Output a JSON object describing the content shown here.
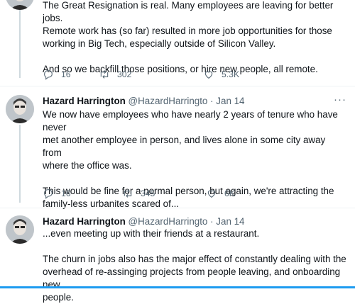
{
  "tweets": [
    {
      "author_name": "",
      "author_handle": "",
      "date": "",
      "text": "The Great Resignation is real. Many employees are leaving for better jobs.\nRemote work has (so far) resulted in more job opportunities for those\nworking in Big Tech, especially outside of Silicon Valley.\n\nAnd so we backfill those positions, or hire new people, all remote.",
      "replies": "16",
      "retweets": "302",
      "likes": "5.3K"
    },
    {
      "author_name": "Hazard Harrington",
      "author_handle": "@HazardHarringto",
      "date": "· Jan 14",
      "text": "We now have employees who have nearly 2 years of tenure who have never\nmet another employee in person, and lives alone in some city away from\nwhere the office was.\n\nThis would be fine for a normal person, but again, we're attracting the\nfamily-less urbanites scared of...",
      "replies": "16",
      "retweets": "345",
      "likes": "6K"
    },
    {
      "author_name": "Hazard Harrington",
      "author_handle": "@HazardHarringto",
      "date": "· Jan 14",
      "text": "...even meeting up with their friends at a restaurant.\n\nThe churn in jobs also has the major effect of constantly dealing with the\noverhead of re-assinging projects from people leaving, and onboarding new\npeople.",
      "replies": "",
      "retweets": "",
      "likes": ""
    }
  ],
  "more_label": "···",
  "colors": {
    "accent": "#1d9bf0",
    "muted": "#536471",
    "divider": "#eff3f4"
  },
  "icons": [
    "reply-icon",
    "retweet-icon",
    "like-icon",
    "more-icon"
  ]
}
